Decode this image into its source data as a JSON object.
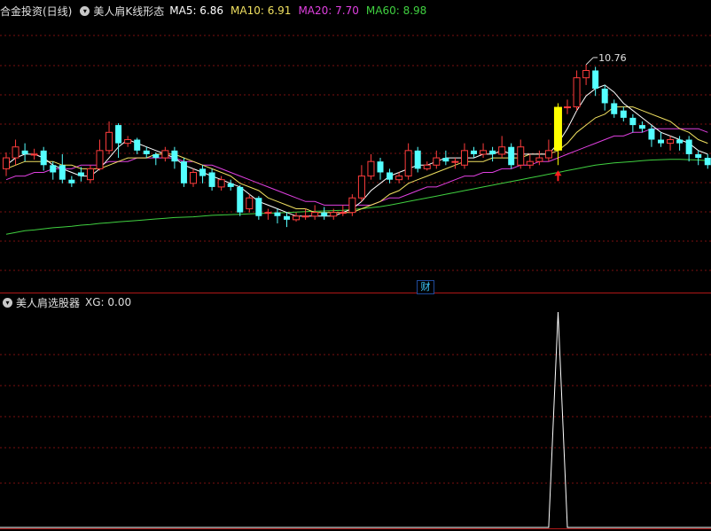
{
  "top_panel": {
    "title": "合金投资(日线)",
    "indicator": "美人肩K线形态",
    "ma": [
      {
        "label": "MA5: 6.86",
        "color": "#ffffff"
      },
      {
        "label": "MA10: 6.91",
        "color": "#f0e060"
      },
      {
        "label": "MA20: 7.70",
        "color": "#e040e0"
      },
      {
        "label": "MA60: 8.98",
        "color": "#40d040"
      }
    ],
    "peak_label": "10.76"
  },
  "divider_button": "财",
  "bottom_panel": {
    "title": "美人肩选股器",
    "xg_label": "XG: 0.00"
  },
  "chart_data": {
    "type": "candlestick",
    "y_range": [
      4.5,
      12.0
    ],
    "peak_price": 10.76,
    "candles": [
      [
        7.9,
        8.2,
        8.35,
        7.7
      ],
      [
        8.2,
        8.5,
        8.7,
        8.0
      ],
      [
        8.4,
        8.3,
        8.6,
        8.1
      ],
      [
        8.3,
        8.3,
        8.45,
        8.15
      ],
      [
        8.4,
        8.0,
        8.5,
        7.85
      ],
      [
        8.0,
        7.8,
        8.1,
        7.6
      ],
      [
        8.0,
        7.6,
        8.3,
        7.5
      ],
      [
        7.6,
        7.5,
        7.7,
        7.4
      ],
      [
        7.8,
        7.7,
        7.95,
        7.55
      ],
      [
        7.6,
        7.9,
        8.0,
        7.5
      ],
      [
        7.9,
        8.4,
        8.7,
        7.85
      ],
      [
        8.4,
        8.9,
        9.2,
        8.3
      ],
      [
        9.1,
        8.6,
        9.15,
        8.2
      ],
      [
        8.6,
        8.7,
        8.8,
        8.5
      ],
      [
        8.7,
        8.4,
        8.75,
        8.3
      ],
      [
        8.4,
        8.3,
        8.5,
        8.2
      ],
      [
        8.3,
        8.2,
        8.35,
        8.0
      ],
      [
        8.2,
        8.4,
        8.5,
        8.1
      ],
      [
        8.4,
        8.1,
        8.5,
        7.9
      ],
      [
        8.1,
        7.5,
        8.2,
        7.4
      ],
      [
        7.5,
        7.8,
        7.9,
        7.4
      ],
      [
        7.9,
        7.7,
        8.0,
        7.5
      ],
      [
        7.8,
        7.4,
        7.9,
        7.3
      ],
      [
        7.4,
        7.6,
        7.7,
        7.3
      ],
      [
        7.5,
        7.4,
        7.6,
        7.3
      ],
      [
        7.4,
        6.7,
        7.45,
        6.6
      ],
      [
        6.8,
        7.1,
        7.2,
        6.7
      ],
      [
        7.1,
        6.6,
        7.15,
        6.5
      ],
      [
        6.7,
        6.7,
        6.8,
        6.5
      ],
      [
        6.7,
        6.6,
        6.8,
        6.4
      ],
      [
        6.6,
        6.5,
        6.7,
        6.3
      ],
      [
        6.5,
        6.6,
        6.7,
        6.45
      ],
      [
        6.6,
        6.6,
        6.8,
        6.5
      ],
      [
        6.6,
        6.7,
        6.9,
        6.5
      ],
      [
        6.7,
        6.6,
        6.85,
        6.5
      ],
      [
        6.6,
        6.7,
        6.8,
        6.5
      ],
      [
        6.7,
        6.7,
        6.9,
        6.6
      ],
      [
        6.7,
        7.1,
        7.2,
        6.6
      ],
      [
        7.1,
        7.7,
        8.0,
        7.0
      ],
      [
        7.7,
        8.1,
        8.3,
        7.6
      ],
      [
        8.1,
        7.8,
        8.2,
        7.6
      ],
      [
        7.8,
        7.6,
        7.9,
        7.5
      ],
      [
        7.6,
        7.7,
        7.8,
        7.5
      ],
      [
        7.7,
        8.4,
        8.6,
        7.6
      ],
      [
        8.4,
        7.9,
        8.5,
        7.8
      ],
      [
        7.9,
        8.0,
        8.1,
        7.85
      ],
      [
        8.0,
        8.2,
        8.4,
        7.9
      ],
      [
        8.2,
        8.1,
        8.4,
        8.0
      ],
      [
        8.1,
        8.1,
        8.2,
        7.9
      ],
      [
        8.0,
        8.4,
        8.6,
        7.9
      ],
      [
        8.4,
        8.3,
        8.5,
        8.2
      ],
      [
        8.3,
        8.4,
        8.6,
        8.2
      ],
      [
        8.4,
        8.3,
        8.5,
        8.1
      ],
      [
        8.3,
        8.5,
        8.8,
        8.2
      ],
      [
        8.5,
        8.0,
        8.6,
        7.9
      ],
      [
        8.0,
        8.5,
        8.7,
        7.9
      ],
      [
        8.0,
        8.1,
        8.3,
        7.9
      ],
      [
        8.1,
        8.2,
        8.4,
        8.0
      ],
      [
        8.2,
        8.4,
        8.7,
        8.1
      ],
      [
        8.4,
        9.6,
        9.7,
        8.0
      ],
      [
        9.6,
        9.6,
        9.8,
        9.4
      ],
      [
        9.6,
        10.4,
        10.6,
        9.5
      ],
      [
        10.4,
        10.6,
        10.76,
        10.2
      ],
      [
        10.6,
        10.1,
        10.7,
        9.9
      ],
      [
        10.1,
        9.7,
        10.2,
        9.5
      ],
      [
        9.7,
        9.4,
        9.8,
        9.3
      ],
      [
        9.5,
        9.3,
        9.6,
        9.2
      ],
      [
        9.3,
        9.1,
        9.4,
        8.9
      ],
      [
        9.1,
        9.0,
        9.2,
        8.9
      ],
      [
        9.0,
        8.7,
        9.1,
        8.5
      ],
      [
        8.7,
        8.6,
        8.9,
        8.5
      ],
      [
        8.6,
        8.7,
        8.8,
        8.4
      ],
      [
        8.7,
        8.6,
        8.8,
        8.4
      ],
      [
        8.7,
        8.3,
        8.8,
        8.1
      ],
      [
        8.3,
        8.2,
        8.4,
        8.0
      ],
      [
        8.2,
        8.0,
        8.3,
        7.9
      ]
    ],
    "ma5": [
      8.0,
      8.2,
      8.3,
      8.3,
      8.2,
      8.0,
      7.9,
      7.8,
      7.7,
      7.7,
      7.9,
      8.2,
      8.5,
      8.7,
      8.6,
      8.5,
      8.4,
      8.3,
      8.2,
      8.0,
      7.9,
      7.8,
      7.7,
      7.6,
      7.5,
      7.4,
      7.2,
      7.0,
      6.9,
      6.8,
      6.7,
      6.6,
      6.6,
      6.6,
      6.6,
      6.6,
      6.7,
      6.8,
      7.0,
      7.3,
      7.5,
      7.7,
      7.8,
      7.9,
      8.0,
      8.0,
      8.1,
      8.2,
      8.2,
      8.2,
      8.2,
      8.3,
      8.3,
      8.4,
      8.3,
      8.3,
      8.3,
      8.3,
      8.3,
      8.6,
      9.0,
      9.5,
      9.9,
      10.1,
      10.2,
      10.0,
      9.7,
      9.5,
      9.3,
      9.1,
      8.9,
      8.8,
      8.7,
      8.6,
      8.4,
      8.3
    ],
    "ma10": [
      7.9,
      8.0,
      8.1,
      8.1,
      8.1,
      8.1,
      8.0,
      8.0,
      7.9,
      7.9,
      7.9,
      8.0,
      8.1,
      8.2,
      8.2,
      8.2,
      8.3,
      8.3,
      8.3,
      8.2,
      8.1,
      8.0,
      7.9,
      7.8,
      7.7,
      7.5,
      7.4,
      7.3,
      7.1,
      7.0,
      6.9,
      6.8,
      6.8,
      6.7,
      6.7,
      6.7,
      6.7,
      6.7,
      6.8,
      6.9,
      7.0,
      7.2,
      7.3,
      7.5,
      7.6,
      7.7,
      7.8,
      7.9,
      8.0,
      8.1,
      8.1,
      8.1,
      8.2,
      8.2,
      8.2,
      8.2,
      8.3,
      8.3,
      8.3,
      8.4,
      8.6,
      8.9,
      9.1,
      9.3,
      9.4,
      9.6,
      9.6,
      9.6,
      9.5,
      9.4,
      9.3,
      9.2,
      9.0,
      8.9,
      8.7,
      8.6
    ],
    "ma20": [
      7.6,
      7.7,
      7.7,
      7.8,
      7.8,
      7.9,
      7.9,
      7.9,
      8.0,
      8.0,
      8.0,
      8.1,
      8.1,
      8.1,
      8.2,
      8.2,
      8.2,
      8.2,
      8.2,
      8.1,
      8.1,
      8.0,
      8.0,
      7.9,
      7.8,
      7.7,
      7.6,
      7.5,
      7.4,
      7.3,
      7.2,
      7.1,
      7.0,
      7.0,
      6.9,
      6.9,
      6.9,
      6.9,
      6.9,
      6.9,
      7.0,
      7.1,
      7.1,
      7.2,
      7.3,
      7.4,
      7.4,
      7.5,
      7.6,
      7.7,
      7.7,
      7.8,
      7.8,
      7.9,
      7.9,
      8.0,
      8.0,
      8.1,
      8.1,
      8.2,
      8.3,
      8.4,
      8.5,
      8.6,
      8.7,
      8.8,
      8.8,
      8.9,
      8.9,
      9.0,
      9.0,
      9.0,
      9.0,
      9.0,
      9.0,
      8.9
    ],
    "ma60": [
      6.1,
      6.15,
      6.2,
      6.22,
      6.25,
      6.28,
      6.3,
      6.32,
      6.35,
      6.37,
      6.4,
      6.42,
      6.44,
      6.46,
      6.48,
      6.5,
      6.52,
      6.54,
      6.56,
      6.57,
      6.58,
      6.6,
      6.62,
      6.63,
      6.64,
      6.65,
      6.66,
      6.67,
      6.68,
      6.69,
      6.7,
      6.71,
      6.72,
      6.73,
      6.74,
      6.75,
      6.76,
      6.78,
      6.8,
      6.83,
      6.86,
      6.9,
      6.95,
      7.0,
      7.05,
      7.1,
      7.15,
      7.2,
      7.25,
      7.3,
      7.35,
      7.4,
      7.45,
      7.5,
      7.55,
      7.6,
      7.65,
      7.7,
      7.75,
      7.8,
      7.85,
      7.9,
      7.95,
      8.0,
      8.03,
      8.06,
      8.08,
      8.1,
      8.12,
      8.14,
      8.15,
      8.16,
      8.16,
      8.15,
      8.14,
      8.12
    ],
    "signal_index": 59,
    "xg_values": "all 0 except 1.0 at signal_index"
  }
}
